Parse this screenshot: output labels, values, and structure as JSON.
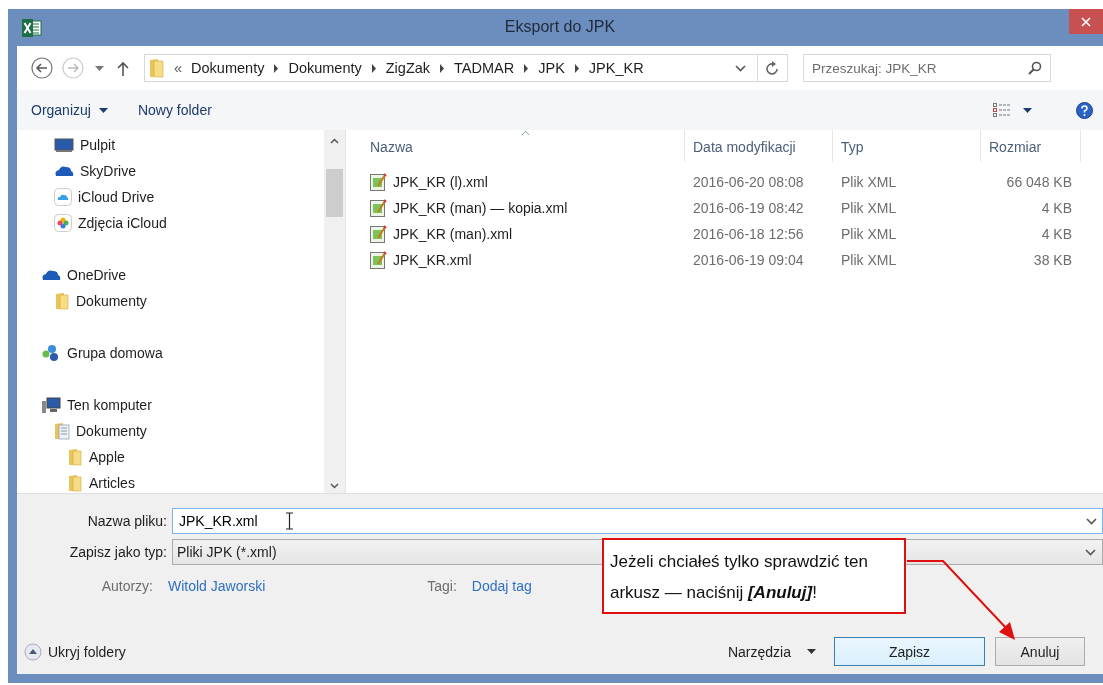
{
  "window": {
    "title": "Eksport do JPK"
  },
  "address": {
    "overflow": "«",
    "path": [
      "Dokumenty",
      "Dokumenty",
      "ZigZak",
      "TADMAR",
      "JPK",
      "JPK_KR"
    ]
  },
  "search": {
    "placeholder": "Przeszukaj: JPK_KR"
  },
  "toolbar": {
    "organize": "Organizuj",
    "new_folder": "Nowy folder"
  },
  "nav": [
    {
      "children": [
        {
          "label": "Pulpit",
          "kind": "desktop"
        },
        {
          "label": "SkyDrive",
          "kind": "cloud"
        },
        {
          "label": "iCloud Drive",
          "kind": "icloud"
        },
        {
          "label": "Zdjęcia iCloud",
          "kind": "photos"
        }
      ]
    },
    {
      "label": "OneDrive",
      "kind": "cloud",
      "children": [
        {
          "label": "Dokumenty",
          "kind": "folder"
        }
      ]
    },
    {
      "label": "Grupa domowa",
      "kind": "homegroup"
    },
    {
      "label": "Ten komputer",
      "kind": "computer",
      "children": [
        {
          "label": "Dokumenty",
          "kind": "library",
          "children": [
            {
              "label": "Apple",
              "kind": "folder"
            },
            {
              "label": "Articles",
              "kind": "folder"
            }
          ]
        }
      ]
    }
  ],
  "files": {
    "columns": [
      {
        "label": "Nazwa",
        "sorted": true
      },
      {
        "label": "Data modyfikacji",
        "sorted": false
      },
      {
        "label": "Typ",
        "sorted": false
      },
      {
        "label": "Rozmiar",
        "sorted": false
      }
    ],
    "rows": [
      {
        "name": "JPK_KR (l).xml",
        "modified": "2016-06-20 08:08",
        "type": "Plik XML",
        "size": "66 048 KB"
      },
      {
        "name": "JPK_KR (man) — kopia.xml",
        "modified": "2016-06-19 08:42",
        "type": "Plik XML",
        "size": "4 KB"
      },
      {
        "name": "JPK_KR (man).xml",
        "modified": "2016-06-18 12:56",
        "type": "Plik XML",
        "size": "4 KB"
      },
      {
        "name": "JPK_KR.xml",
        "modified": "2016-06-19 09:04",
        "type": "Plik XML",
        "size": "38 KB"
      }
    ]
  },
  "form": {
    "fields": [
      {
        "label": "Nazwa pliku:",
        "value": "JPK_KR.xml",
        "kind": "text"
      },
      {
        "label": "Zapisz jako typ:",
        "value": "Pliki JPK (*.xml)",
        "kind": "select"
      }
    ],
    "meta": [
      {
        "label": "Autorzy:",
        "value": "Witold Jaworski"
      },
      {
        "label": "Tagi:",
        "value": "Dodaj tag"
      }
    ]
  },
  "hide_folders": "Ukryj foldery",
  "tools": "Narzędzia",
  "buttons": [
    {
      "label": "Zapisz",
      "default": true
    },
    {
      "label": "Anuluj",
      "default": false
    }
  ],
  "callout": "Jeżeli chciałeś tylko sprawdzić ten arkusz — naciśnij **[Anuluj]**!"
}
